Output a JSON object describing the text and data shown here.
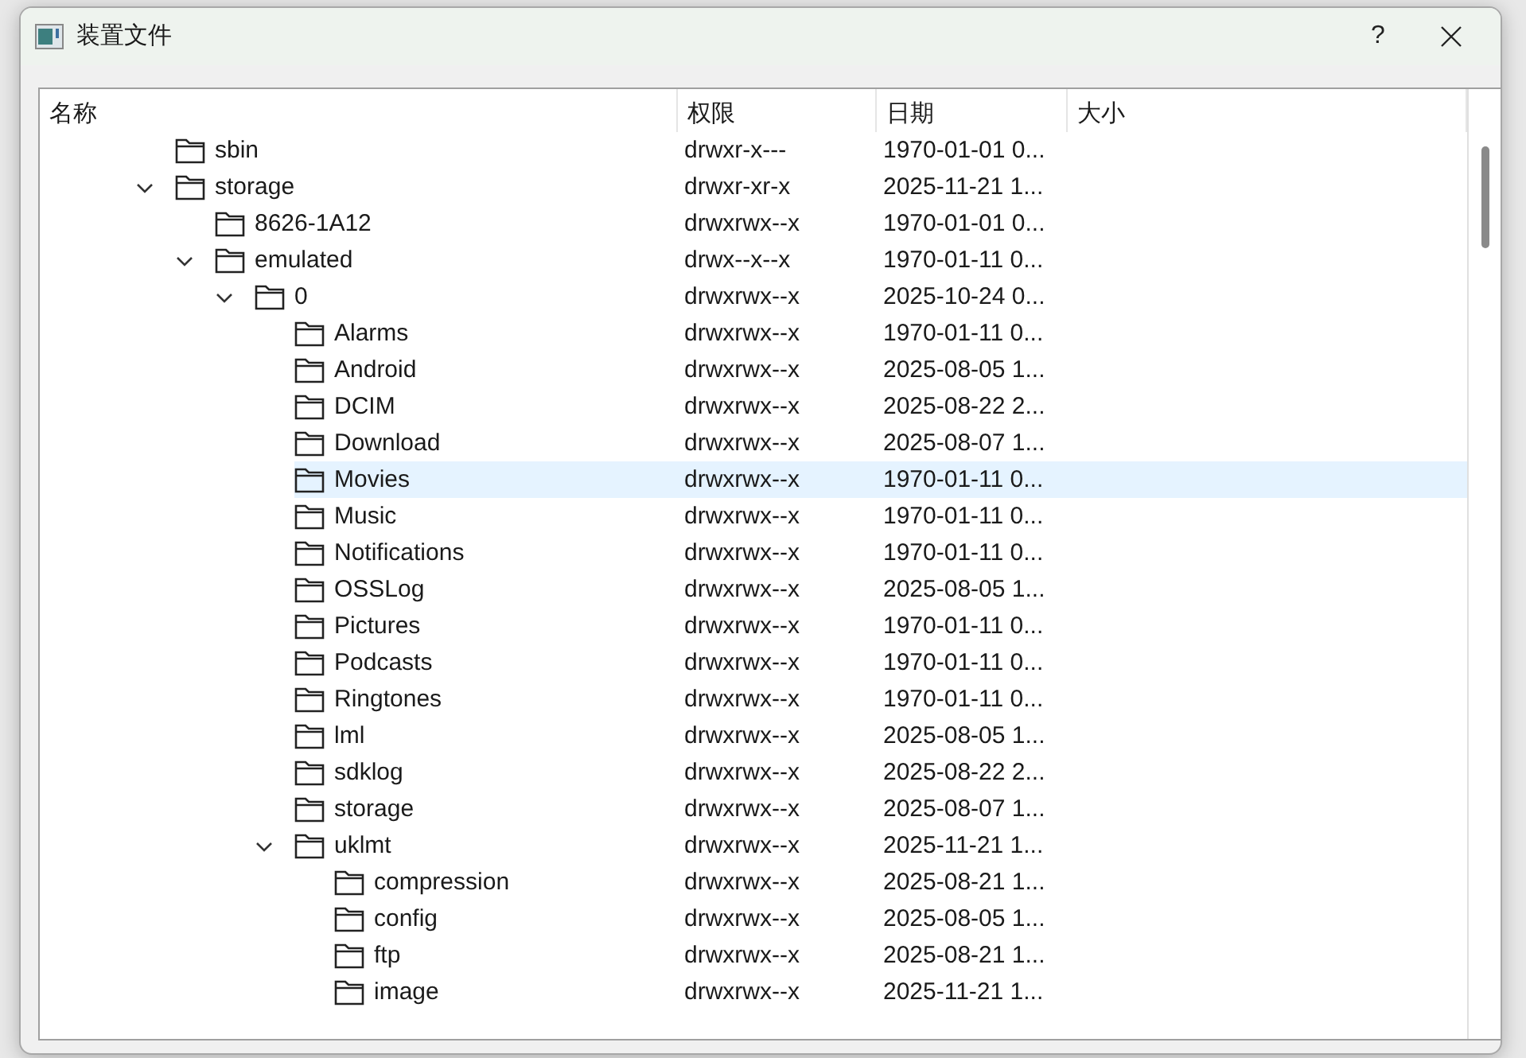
{
  "window": {
    "title": "装置文件",
    "buttons": [
      "?"
    ]
  },
  "tree": {
    "columns": [
      "名称",
      "权限",
      "日期",
      "大小"
    ],
    "rows": [
      {
        "name": "sbin",
        "permissions": "drwxr-x---",
        "date": "1970-01-01 0...",
        "expanded": false,
        "selected": false
      },
      {
        "name": "storage",
        "permissions": "drwxr-xr-x",
        "date": "2025-11-21 1...",
        "expanded": true,
        "selected": false,
        "children": [
          {
            "name": "8626-1A12",
            "permissions": "drwxrwx--x",
            "date": "1970-01-01 0...",
            "expanded": false,
            "selected": false
          },
          {
            "name": "emulated",
            "permissions": "drwx--x--x",
            "date": "1970-01-11 0...",
            "expanded": true,
            "selected": false,
            "children": [
              {
                "name": "0",
                "permissions": "drwxrwx--x",
                "date": "2025-10-24 0...",
                "expanded": true,
                "selected": false,
                "children": [
                  {
                    "name": "Alarms",
                    "permissions": "drwxrwx--x",
                    "date": "1970-01-11 0...",
                    "expanded": false,
                    "selected": false
                  },
                  {
                    "name": "Android",
                    "permissions": "drwxrwx--x",
                    "date": "2025-08-05 1...",
                    "expanded": false,
                    "selected": false
                  },
                  {
                    "name": "DCIM",
                    "permissions": "drwxrwx--x",
                    "date": "2025-08-22 2...",
                    "expanded": false,
                    "selected": false
                  },
                  {
                    "name": "Download",
                    "permissions": "drwxrwx--x",
                    "date": "2025-08-07 1...",
                    "expanded": false,
                    "selected": false
                  },
                  {
                    "name": "Movies",
                    "permissions": "drwxrwx--x",
                    "date": "1970-01-11 0...",
                    "expanded": false,
                    "selected": true
                  },
                  {
                    "name": "Music",
                    "permissions": "drwxrwx--x",
                    "date": "1970-01-11 0...",
                    "expanded": false,
                    "selected": false
                  },
                  {
                    "name": "Notifications",
                    "permissions": "drwxrwx--x",
                    "date": "1970-01-11 0...",
                    "expanded": false,
                    "selected": false
                  },
                  {
                    "name": "OSSLog",
                    "permissions": "drwxrwx--x",
                    "date": "2025-08-05 1...",
                    "expanded": false,
                    "selected": false
                  },
                  {
                    "name": "Pictures",
                    "permissions": "drwxrwx--x",
                    "date": "1970-01-11 0...",
                    "expanded": false,
                    "selected": false
                  },
                  {
                    "name": "Podcasts",
                    "permissions": "drwxrwx--x",
                    "date": "1970-01-11 0...",
                    "expanded": false,
                    "selected": false
                  },
                  {
                    "name": "Ringtones",
                    "permissions": "drwxrwx--x",
                    "date": "1970-01-11 0...",
                    "expanded": false,
                    "selected": false
                  },
                  {
                    "name": "lml",
                    "permissions": "drwxrwx--x",
                    "date": "2025-08-05 1...",
                    "expanded": false,
                    "selected": false
                  },
                  {
                    "name": "sdklog",
                    "permissions": "drwxrwx--x",
                    "date": "2025-08-22 2...",
                    "expanded": false,
                    "selected": false
                  },
                  {
                    "name": "storage",
                    "permissions": "drwxrwx--x",
                    "date": "2025-08-07 1...",
                    "expanded": false,
                    "selected": false
                  },
                  {
                    "name": "uklmt",
                    "permissions": "drwxrwx--x",
                    "date": "2025-11-21 1...",
                    "expanded": true,
                    "selected": false,
                    "children": [
                      {
                        "name": "compression",
                        "permissions": "drwxrwx--x",
                        "date": "2025-08-21 1...",
                        "expanded": false,
                        "selected": false
                      },
                      {
                        "name": "config",
                        "permissions": "drwxrwx--x",
                        "date": "2025-08-05 1...",
                        "expanded": false,
                        "selected": false
                      },
                      {
                        "name": "ftp",
                        "permissions": "drwxrwx--x",
                        "date": "2025-08-21 1...",
                        "expanded": false,
                        "selected": false
                      },
                      {
                        "name": "image",
                        "permissions": "drwxrwx--x",
                        "date": "2025-11-21 1...",
                        "expanded": false,
                        "selected": false
                      }
                    ]
                  }
                ]
              }
            ]
          }
        ]
      }
    ]
  }
}
